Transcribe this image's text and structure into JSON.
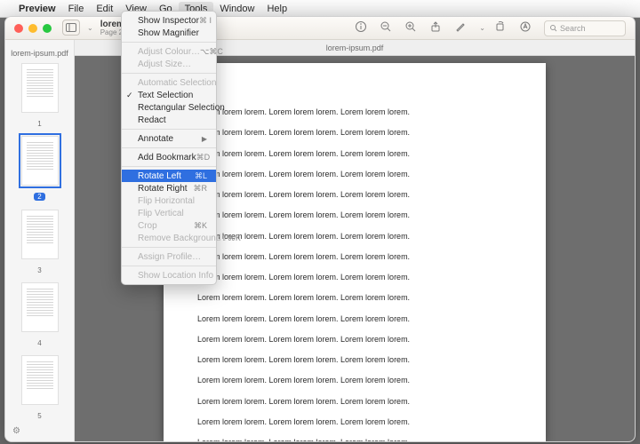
{
  "menubar": {
    "app": "Preview",
    "items": [
      "File",
      "Edit",
      "View",
      "Go",
      "Tools",
      "Window",
      "Help"
    ],
    "open": "Tools"
  },
  "window": {
    "title": "lorem-ipsum.pdf",
    "subtitle": "Page 2 of 5",
    "doclabel": "lorem-ipsum.pdf",
    "search_placeholder": "Search"
  },
  "sidebar": {
    "filename": "lorem-ipsum.pdf",
    "thumbs": [
      {
        "num": "1",
        "selected": false,
        "badge": false
      },
      {
        "num": "2",
        "selected": true,
        "badge": true
      },
      {
        "num": "3",
        "selected": false,
        "badge": false
      },
      {
        "num": "4",
        "selected": false,
        "badge": false
      },
      {
        "num": "5",
        "selected": false,
        "badge": false
      }
    ]
  },
  "menu": {
    "items": [
      {
        "label": "Show Inspector",
        "sc": "⌘ I"
      },
      {
        "label": "Show Magnifier"
      },
      {
        "sep": true
      },
      {
        "label": "Adjust Colour…",
        "sc": "⌥⌘C",
        "disabled": true
      },
      {
        "label": "Adjust Size…",
        "disabled": true
      },
      {
        "sep": true
      },
      {
        "label": "Automatic Selection",
        "disabled": true
      },
      {
        "label": "Text Selection",
        "checked": true
      },
      {
        "label": "Rectangular Selection"
      },
      {
        "label": "Redact"
      },
      {
        "sep": true
      },
      {
        "label": "Annotate",
        "submenu": true
      },
      {
        "sep": true
      },
      {
        "label": "Add Bookmark",
        "sc": "⌘D"
      },
      {
        "sep": true
      },
      {
        "label": "Rotate Left",
        "sc": "⌘L",
        "highlighted": true
      },
      {
        "label": "Rotate Right",
        "sc": "⌘R"
      },
      {
        "label": "Flip Horizontal",
        "disabled": true
      },
      {
        "label": "Flip Vertical",
        "disabled": true
      },
      {
        "label": "Crop",
        "sc": "⌘K",
        "disabled": true
      },
      {
        "label": "Remove Background",
        "sc": "⇧⌘K",
        "disabled": true
      },
      {
        "sep": true
      },
      {
        "label": "Assign Profile…",
        "disabled": true
      },
      {
        "sep": true
      },
      {
        "label": "Show Location Info",
        "disabled": true
      }
    ]
  },
  "document": {
    "line": "Lorem lorem lorem. Lorem lorem lorem. Lorem lorem lorem.",
    "lines": 17
  }
}
